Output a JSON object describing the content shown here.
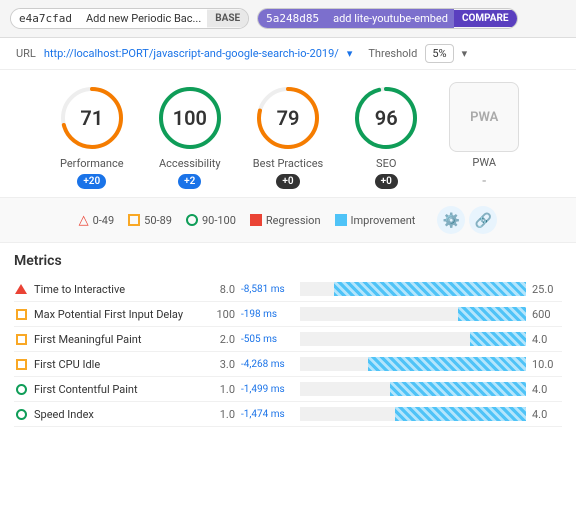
{
  "topBar": {
    "base": {
      "hash": "e4a7cfad",
      "message": "Add new Periodic Bac...",
      "type": "BASE"
    },
    "compare": {
      "hash": "5a248d85",
      "message": "add lite-youtube-embed",
      "type": "COMPARE"
    }
  },
  "urlBar": {
    "label": "URL",
    "url": "http://localhost:PORT/javascript-and-google-search-io-2019/",
    "thresholdLabel": "Threshold",
    "thresholdValue": "5%"
  },
  "scores": [
    {
      "id": "performance",
      "label": "Performance",
      "value": "71",
      "badge": "+20",
      "badgeType": "positive",
      "color": "#f57c00",
      "percent": 71
    },
    {
      "id": "accessibility",
      "label": "Accessibility",
      "value": "100",
      "badge": "+2",
      "badgeType": "positive",
      "color": "#0f9d58",
      "percent": 100
    },
    {
      "id": "best-practices",
      "label": "Best Practices",
      "value": "79",
      "badge": "+0",
      "badgeType": "neutral",
      "color": "#f57c00",
      "percent": 79
    },
    {
      "id": "seo",
      "label": "SEO",
      "value": "96",
      "badge": "+0",
      "badgeType": "neutral",
      "color": "#0f9d58",
      "percent": 96
    },
    {
      "id": "pwa",
      "label": "PWA",
      "badge": "-",
      "badgeType": "dash",
      "isPwa": true
    }
  ],
  "legend": {
    "items": [
      {
        "id": "range-0-49",
        "shape": "triangle",
        "label": "0-49",
        "color": "#ea4335"
      },
      {
        "id": "range-50-89",
        "shape": "square",
        "label": "50-89",
        "color": "#f9a825"
      },
      {
        "id": "range-90-100",
        "shape": "circle",
        "label": "90-100",
        "color": "#0f9d58"
      },
      {
        "id": "regression",
        "shape": "rect",
        "label": "Regression",
        "color": "#ea4335"
      },
      {
        "id": "improvement",
        "shape": "rect",
        "label": "Improvement",
        "color": "#4fc3f7"
      }
    ]
  },
  "metrics": {
    "title": "Metrics",
    "rows": [
      {
        "id": "tti",
        "icon": "triangle",
        "name": "Time to Interactive",
        "baseVal": "8.0",
        "change": "-8,581 ms",
        "barPct": 85,
        "compareVal": "25.0"
      },
      {
        "id": "mpfid",
        "icon": "square",
        "name": "Max Potential First Input Delay",
        "baseVal": "100",
        "change": "-198 ms",
        "barPct": 30,
        "compareVal": "600"
      },
      {
        "id": "fmp",
        "icon": "square",
        "name": "First Meaningful Paint",
        "baseVal": "2.0",
        "change": "-505 ms",
        "barPct": 25,
        "compareVal": "4.0"
      },
      {
        "id": "fci",
        "icon": "square",
        "name": "First CPU Idle",
        "baseVal": "3.0",
        "change": "-4,268 ms",
        "barPct": 70,
        "compareVal": "10.0"
      },
      {
        "id": "fcp",
        "icon": "circle",
        "name": "First Contentful Paint",
        "baseVal": "1.0",
        "change": "-1,499 ms",
        "barPct": 60,
        "compareVal": "4.0"
      },
      {
        "id": "si",
        "icon": "circle",
        "name": "Speed Index",
        "baseVal": "1.0",
        "change": "-1,474 ms",
        "barPct": 58,
        "compareVal": "4.0"
      }
    ]
  }
}
